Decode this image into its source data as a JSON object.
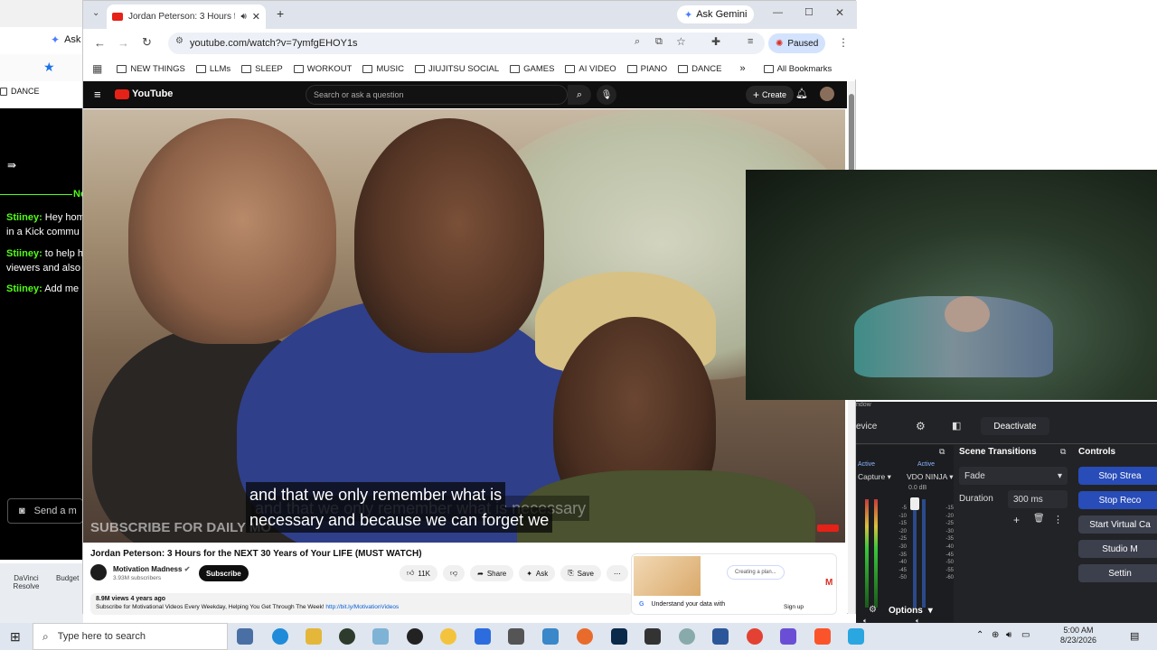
{
  "left_panel": {
    "ask_label": "Ask",
    "dance_label": "DANCE",
    "banner_partial": "Ne",
    "chat": [
      {
        "user": "Stiiney:",
        "text": "Hey hom",
        "cont": "in a Kick commu"
      },
      {
        "user": "Stiiney:",
        "text": "to help h",
        "cont": "viewers and also"
      },
      {
        "user": "Stiiney:",
        "text": "Add me",
        "cont": ""
      }
    ],
    "send_placeholder": "Send a m",
    "desktop_icons": [
      "DaVinci Resolve",
      "Budget"
    ]
  },
  "browser": {
    "tab_title": "Jordan Peterson: 3 Hours fo",
    "new_tab": "+",
    "ask_gemini": "Ask Gemini",
    "url": "youtube.com/watch?v=7ymfgEHOY1s",
    "paused_label": "Paused",
    "bookmarks": [
      "NEW THINGS",
      "LLMs",
      "SLEEP",
      "WORKOUT",
      "MUSIC",
      "JIUJITSU SOCIAL",
      "GAMES",
      "AI VIDEO",
      "PIANO",
      "DANCE"
    ],
    "all_bookmarks": "All Bookmarks"
  },
  "youtube": {
    "logo": "YouTube",
    "search_placeholder": "Search or ask a question",
    "create_label": "Create",
    "caption_line1": "and that we only remember what is",
    "caption_line2": "necessary and because we can forget we",
    "caption_ghost": "and that we only remember what is necessary",
    "overlay_subscribe": "SUBSCRIBE FOR DAILY MO",
    "video_title": "Jordan Peterson: 3 Hours for the NEXT 30 Years of Your LIFE (MUST WATCH)",
    "channel_name": "Motivation Madness",
    "subscribers": "3.93M subscribers",
    "subscribe_button": "Subscribe",
    "likes": "11K",
    "share": "Share",
    "ask": "Ask",
    "save": "Save",
    "views_line": "8.9M views  4 years ago",
    "description": "Subscribe for Motivational Videos Every Weekday, Helping You Get Through The Week!",
    "description_link": "http://bit.ly/MotivationVideos",
    "ad_text": "Understand your data with",
    "ad_sign": "Sign up",
    "ad_creating": "Creating a plan..."
  },
  "obs": {
    "device_label": "evice",
    "deactivate": "Deactivate",
    "window_partial": "ndow",
    "scene_transitions": "Scene Transitions",
    "controls": "Controls",
    "active1": "Active",
    "active2": "Active",
    "capture_label": "Capture",
    "vdo_label": "VDO NINJA",
    "db_label": "0.0 dB",
    "fade": "Fade",
    "duration_label": "Duration",
    "duration_value": "300 ms",
    "stop_stream": "Stop Strea",
    "stop_record": "Stop Reco",
    "start_virtual": "Start Virtual Ca",
    "studio": "Studio M",
    "settings": "Settin",
    "options": "Options",
    "meter_ticks": [
      "-5",
      "-10",
      "-15",
      "-20",
      "-25",
      "-30",
      "-35",
      "-40",
      "-45",
      "-50",
      "-55",
      "-60"
    ]
  },
  "taskbar": {
    "search_placeholder": "Type here to search",
    "time": "5:00 AM",
    "date": "8/23/2026"
  }
}
